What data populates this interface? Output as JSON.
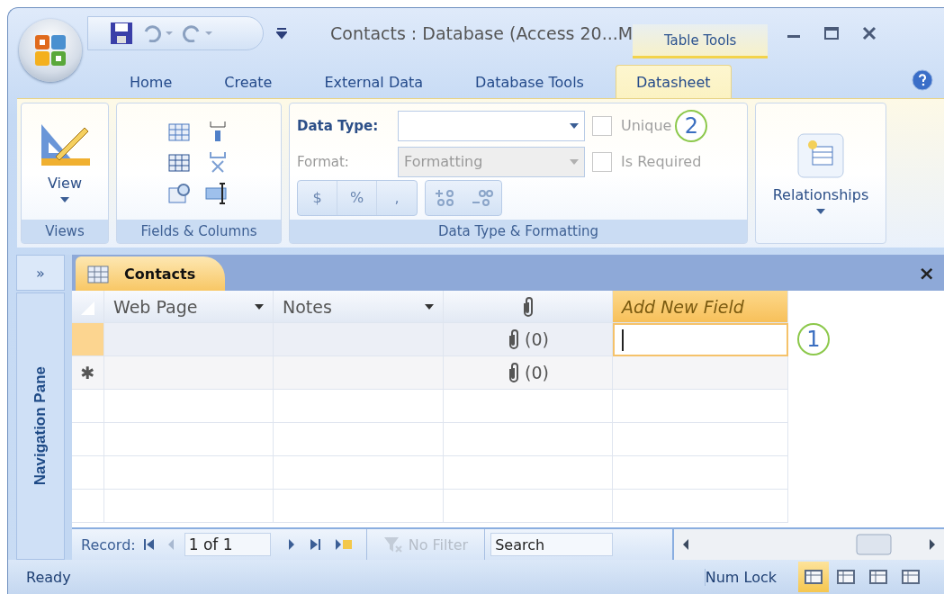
{
  "title_bar": {
    "title": "Contacts : Database (Access 20...M",
    "context_tab": "Table Tools"
  },
  "ribbon_tabs": [
    {
      "label": "Home",
      "selected": false
    },
    {
      "label": "Create",
      "selected": false
    },
    {
      "label": "External Data",
      "selected": false
    },
    {
      "label": "Database Tools",
      "selected": false
    },
    {
      "label": "Datasheet",
      "selected": true
    }
  ],
  "ribbon": {
    "views": {
      "label": "Views",
      "button": "View"
    },
    "fields": {
      "label": "Fields & Columns"
    },
    "formatting": {
      "label": "Data Type & Formatting",
      "data_type": {
        "label": "Data Type:",
        "disabled": false
      },
      "format": {
        "label": "Format:",
        "placeholder": "Formatting",
        "disabled": true
      },
      "symbols": [
        "$",
        "%",
        ","
      ],
      "checkboxes": [
        {
          "label": "Unique",
          "checked": false,
          "disabled": true
        },
        {
          "label": "Is Required",
          "checked": false,
          "disabled": true
        }
      ],
      "callout": "2"
    },
    "relationships": {
      "button": "Relationships"
    }
  },
  "document": {
    "nav_toggle": "»",
    "nav_pane": "Navigation Pane",
    "tab": "Contacts",
    "close": "×"
  },
  "table": {
    "columns": [
      {
        "kind": "text",
        "label": "Web Page"
      },
      {
        "kind": "text",
        "label": "Notes"
      },
      {
        "kind": "attachment"
      },
      {
        "kind": "new",
        "label": "Add New Field"
      }
    ],
    "rows": [
      {
        "current": true,
        "marker": "",
        "attachments": "(0)"
      },
      {
        "current": false,
        "marker": "✱",
        "attachments": "(0)"
      }
    ],
    "callout": "1"
  },
  "record_nav": {
    "label": "Record:",
    "position": "1 of 1",
    "filter": "No Filter",
    "search_placeholder": "Search"
  },
  "status_bar": {
    "text": "Ready",
    "num_lock": "Num Lock",
    "views": [
      {
        "selected": true
      },
      {
        "selected": false
      },
      {
        "selected": false
      },
      {
        "selected": false
      }
    ]
  }
}
